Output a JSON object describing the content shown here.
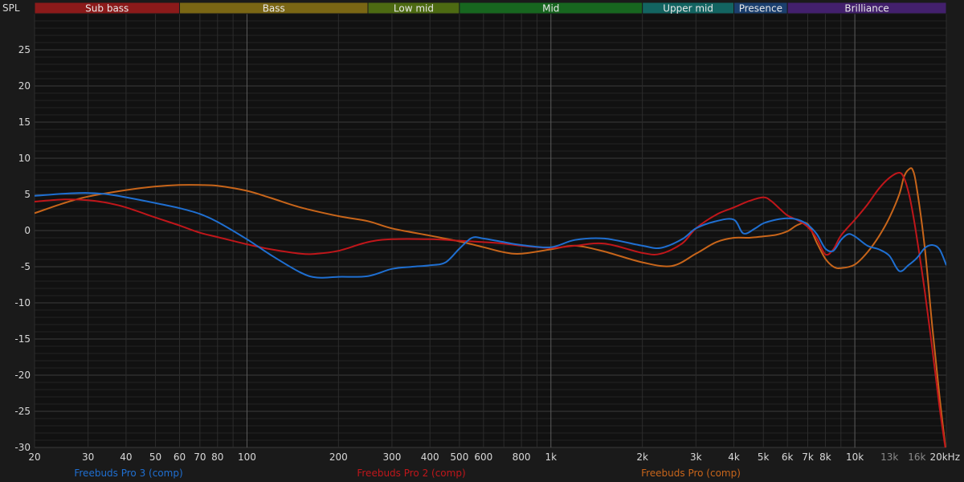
{
  "chart_data": {
    "type": "line",
    "ylabel": "SPL",
    "x_scale": "log",
    "xlim": [
      20,
      20000
    ],
    "ylim": [
      -30,
      30
    ],
    "grid": true,
    "legend_position": "bottom",
    "y_ticks": [
      25,
      20,
      15,
      10,
      5,
      0,
      -5,
      -10,
      -15,
      -20,
      -25,
      -30
    ],
    "y_tick_labels": [
      "25",
      "20",
      "15",
      "10",
      "5",
      "0",
      "-5",
      "-10",
      "-15",
      "-20",
      "-25",
      "-30"
    ],
    "x_ticks": [
      {
        "value": 20,
        "label": "20",
        "style": "normal"
      },
      {
        "value": 30,
        "label": "30",
        "style": "normal"
      },
      {
        "value": 40,
        "label": "40",
        "style": "normal"
      },
      {
        "value": 50,
        "label": "50",
        "style": "normal"
      },
      {
        "value": 60,
        "label": "60",
        "style": "normal"
      },
      {
        "value": 70,
        "label": "70",
        "style": "normal"
      },
      {
        "value": 80,
        "label": "80",
        "style": "normal"
      },
      {
        "value": 100,
        "label": "100",
        "style": "normal"
      },
      {
        "value": 200,
        "label": "200",
        "style": "normal"
      },
      {
        "value": 300,
        "label": "300",
        "style": "normal"
      },
      {
        "value": 400,
        "label": "400",
        "style": "normal"
      },
      {
        "value": 500,
        "label": "500",
        "style": "normal"
      },
      {
        "value": 600,
        "label": "600",
        "style": "normal"
      },
      {
        "value": 800,
        "label": "800",
        "style": "normal"
      },
      {
        "value": 1000,
        "label": "1k",
        "style": "normal"
      },
      {
        "value": 2000,
        "label": "2k",
        "style": "normal"
      },
      {
        "value": 3000,
        "label": "3k",
        "style": "normal"
      },
      {
        "value": 4000,
        "label": "4k",
        "style": "normal"
      },
      {
        "value": 5000,
        "label": "5k",
        "style": "normal"
      },
      {
        "value": 6000,
        "label": "6k",
        "style": "normal"
      },
      {
        "value": 7000,
        "label": "7k",
        "style": "normal"
      },
      {
        "value": 8000,
        "label": "8k",
        "style": "normal"
      },
      {
        "value": 10000,
        "label": "10k",
        "style": "normal"
      },
      {
        "value": 13000,
        "label": "13k",
        "style": "dim"
      },
      {
        "value": 16000,
        "label": "16k",
        "style": "dim"
      },
      {
        "value": 20000,
        "label": "20kHz",
        "style": "normal"
      }
    ],
    "bands": [
      {
        "name": "Sub bass",
        "from": 20,
        "to": 60,
        "color": "#8b1a1a"
      },
      {
        "name": "Bass",
        "from": 60,
        "to": 250,
        "color": "#7a6614"
      },
      {
        "name": "Low mid",
        "from": 250,
        "to": 500,
        "color": "#4d6a12"
      },
      {
        "name": "Mid",
        "from": 500,
        "to": 2000,
        "color": "#17661f"
      },
      {
        "name": "Upper mid",
        "from": 2000,
        "to": 4000,
        "color": "#136461"
      },
      {
        "name": "Presence",
        "from": 4000,
        "to": 6000,
        "color": "#1b3f6e"
      },
      {
        "name": "Brilliance",
        "from": 6000,
        "to": 20000,
        "color": "#43206d"
      }
    ],
    "series": [
      {
        "name": "Freebuds Pro 3  (comp)",
        "color": "#1f6fd1",
        "x": [
          20,
          25,
          30,
          35,
          40,
          50,
          60,
          70,
          80,
          100,
          120,
          150,
          170,
          200,
          250,
          300,
          350,
          400,
          450,
          500,
          550,
          600,
          700,
          800,
          1000,
          1200,
          1500,
          2000,
          2300,
          2700,
          3000,
          3500,
          4000,
          4300,
          4700,
          5000,
          5500,
          6000,
          6500,
          7000,
          7500,
          8000,
          8500,
          9000,
          9500,
          10000,
          11000,
          12000,
          13000,
          14000,
          15000,
          16000,
          17000,
          18000,
          19000,
          20000
        ],
        "y": [
          4.8,
          5.1,
          5.2,
          5.0,
          4.6,
          3.8,
          3.1,
          2.3,
          1.2,
          -1.2,
          -3.4,
          -5.8,
          -6.5,
          -6.4,
          -6.3,
          -5.3,
          -5.0,
          -4.8,
          -4.4,
          -2.5,
          -1.0,
          -1.1,
          -1.6,
          -2.0,
          -2.3,
          -1.3,
          -1.1,
          -2.1,
          -2.4,
          -1.2,
          0.3,
          1.3,
          1.5,
          -0.4,
          0.3,
          1.0,
          1.5,
          1.7,
          1.5,
          0.8,
          -0.5,
          -2.5,
          -2.8,
          -1.3,
          -0.5,
          -0.8,
          -2.1,
          -2.6,
          -3.5,
          -5.6,
          -4.8,
          -3.8,
          -2.4,
          -2.0,
          -2.6,
          -4.8
        ]
      },
      {
        "name": "Freebuds Pro 2 (comp)",
        "color": "#c0161a",
        "x": [
          20,
          25,
          30,
          35,
          40,
          50,
          60,
          70,
          80,
          100,
          120,
          150,
          170,
          200,
          250,
          300,
          400,
          500,
          600,
          700,
          800,
          1000,
          1200,
          1500,
          2000,
          2300,
          2700,
          3000,
          3500,
          4000,
          4500,
          5000,
          5300,
          5700,
          6000,
          6500,
          7000,
          7500,
          8000,
          8500,
          9000,
          10000,
          11000,
          12000,
          13000,
          14000,
          14500,
          15000,
          15500,
          16000,
          17000,
          18000,
          19000,
          20000
        ],
        "y": [
          4.0,
          4.3,
          4.2,
          3.8,
          3.2,
          1.8,
          0.7,
          -0.3,
          -0.9,
          -1.9,
          -2.6,
          -3.2,
          -3.2,
          -2.8,
          -1.6,
          -1.2,
          -1.2,
          -1.4,
          -1.6,
          -1.8,
          -2.1,
          -2.4,
          -2.1,
          -1.8,
          -3.1,
          -3.2,
          -1.8,
          0.3,
          2.2,
          3.2,
          4.1,
          4.6,
          4.1,
          2.9,
          2.1,
          1.4,
          0.5,
          -1.1,
          -3.3,
          -2.6,
          -0.7,
          1.5,
          3.6,
          5.8,
          7.3,
          8.0,
          7.3,
          5.4,
          2.5,
          -1.0,
          -8.5,
          -16.5,
          -24.5,
          -31.0
        ]
      },
      {
        "name": "Freebuds Pro (comp)",
        "color": "#c8651a",
        "x": [
          20,
          25,
          30,
          40,
          50,
          60,
          70,
          80,
          100,
          120,
          150,
          200,
          250,
          300,
          400,
          500,
          600,
          700,
          800,
          1000,
          1200,
          1500,
          2000,
          2500,
          3000,
          3500,
          4000,
          4500,
          5000,
          5500,
          6000,
          6500,
          7000,
          7500,
          8000,
          8500,
          9000,
          10000,
          11000,
          12000,
          13000,
          14000,
          14500,
          15000,
          15500,
          16000,
          17000,
          18000,
          19000,
          20000
        ],
        "y": [
          2.4,
          3.8,
          4.7,
          5.6,
          6.1,
          6.3,
          6.3,
          6.2,
          5.5,
          4.5,
          3.2,
          2.0,
          1.3,
          0.3,
          -0.7,
          -1.5,
          -2.3,
          -3.0,
          -3.2,
          -2.6,
          -2.1,
          -2.9,
          -4.4,
          -4.9,
          -3.2,
          -1.6,
          -1.0,
          -1.0,
          -0.8,
          -0.6,
          -0.1,
          0.8,
          0.9,
          -1.7,
          -3.9,
          -5.0,
          -5.2,
          -4.7,
          -3.0,
          -0.8,
          1.8,
          5.0,
          7.4,
          8.4,
          8.4,
          5.8,
          -2.5,
          -13.5,
          -23.0,
          -31.0
        ]
      }
    ]
  }
}
